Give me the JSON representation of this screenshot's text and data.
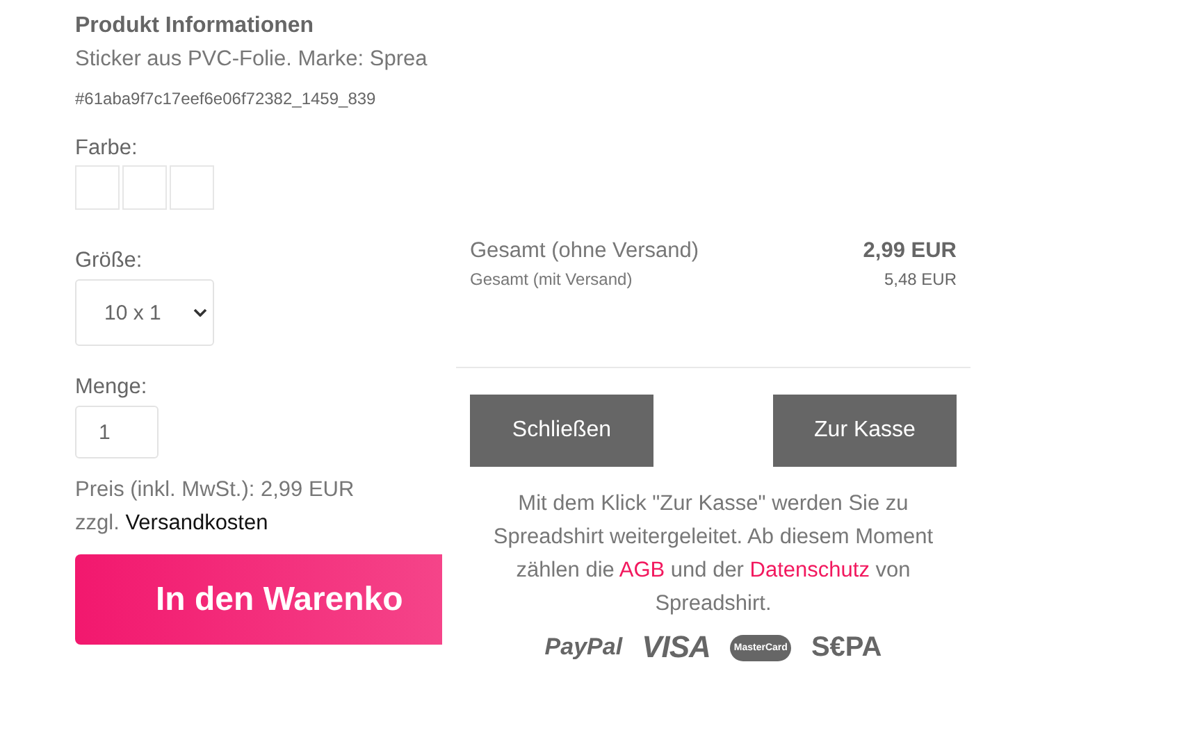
{
  "product": {
    "heading": "Produkt Informationen",
    "description": "Sticker aus PVC-Folie. Marke: Sprea",
    "id": "#61aba9f7c17eef6e06f72382_1459_839",
    "color_label": "Farbe:",
    "swatches": [
      {
        "color": "#ffffff"
      },
      {
        "color": "#ffffff"
      },
      {
        "color": "#ffffff"
      }
    ],
    "size_label": "Größe:",
    "size_value": "10 x 1",
    "quantity_label": "Menge:",
    "quantity_value": "1",
    "price": "Preis (inkl. MwSt.): 2,99 EUR",
    "shipping_prefix": "zzgl.",
    "shipping_link": "Versandkosten",
    "cart_button": "In den Warenko"
  },
  "cart_panel": {
    "totals": [
      {
        "label": "Gesamt (ohne Versand)",
        "value": "2,99 EUR",
        "kind": "main"
      },
      {
        "label": "Gesamt (mit Versand)",
        "value": "5,48 EUR",
        "kind": "sub"
      }
    ],
    "buttons": [
      "Schließen",
      "Zur Kasse"
    ],
    "notice": "Mit dem Klick \"Zur Kasse\" werden Sie zu Spreadshirt weitergeleitet. Ab diesem Moment zählen die ",
    "notice_link_1": "AGB",
    "notice_middle": " und der ",
    "notice_link_2": "Datenschutz",
    "notice_end": " von Spreadshirt.",
    "payment_logos": [
      "PayPal",
      "VISA",
      "MasterCard",
      "S€PA"
    ]
  }
}
